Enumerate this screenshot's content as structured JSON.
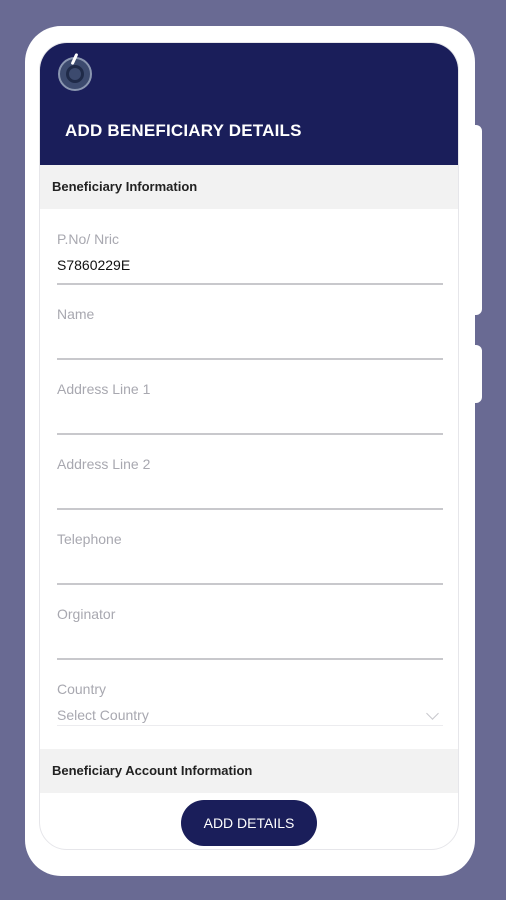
{
  "header": {
    "title": "ADD BENEFICIARY DETAILS",
    "logo_icon": "logo-icon"
  },
  "sections": {
    "beneficiary_info": "Beneficiary Information",
    "account_info": "Beneficiary Account Information"
  },
  "fields": [
    {
      "label": "P.No/ Nric",
      "value": "S7860229E"
    },
    {
      "label": "Name",
      "value": ""
    },
    {
      "label": "Address Line 1",
      "value": ""
    },
    {
      "label": "Address Line 2",
      "value": ""
    },
    {
      "label": "Telephone",
      "value": ""
    },
    {
      "label": "Orginator",
      "value": ""
    }
  ],
  "country": {
    "label": "Country",
    "placeholder": "Select Country"
  },
  "actions": {
    "add_details": "ADD DETAILS"
  },
  "colors": {
    "background": "#696a93",
    "header": "#1a1e5a",
    "button": "#1a1e5a"
  }
}
